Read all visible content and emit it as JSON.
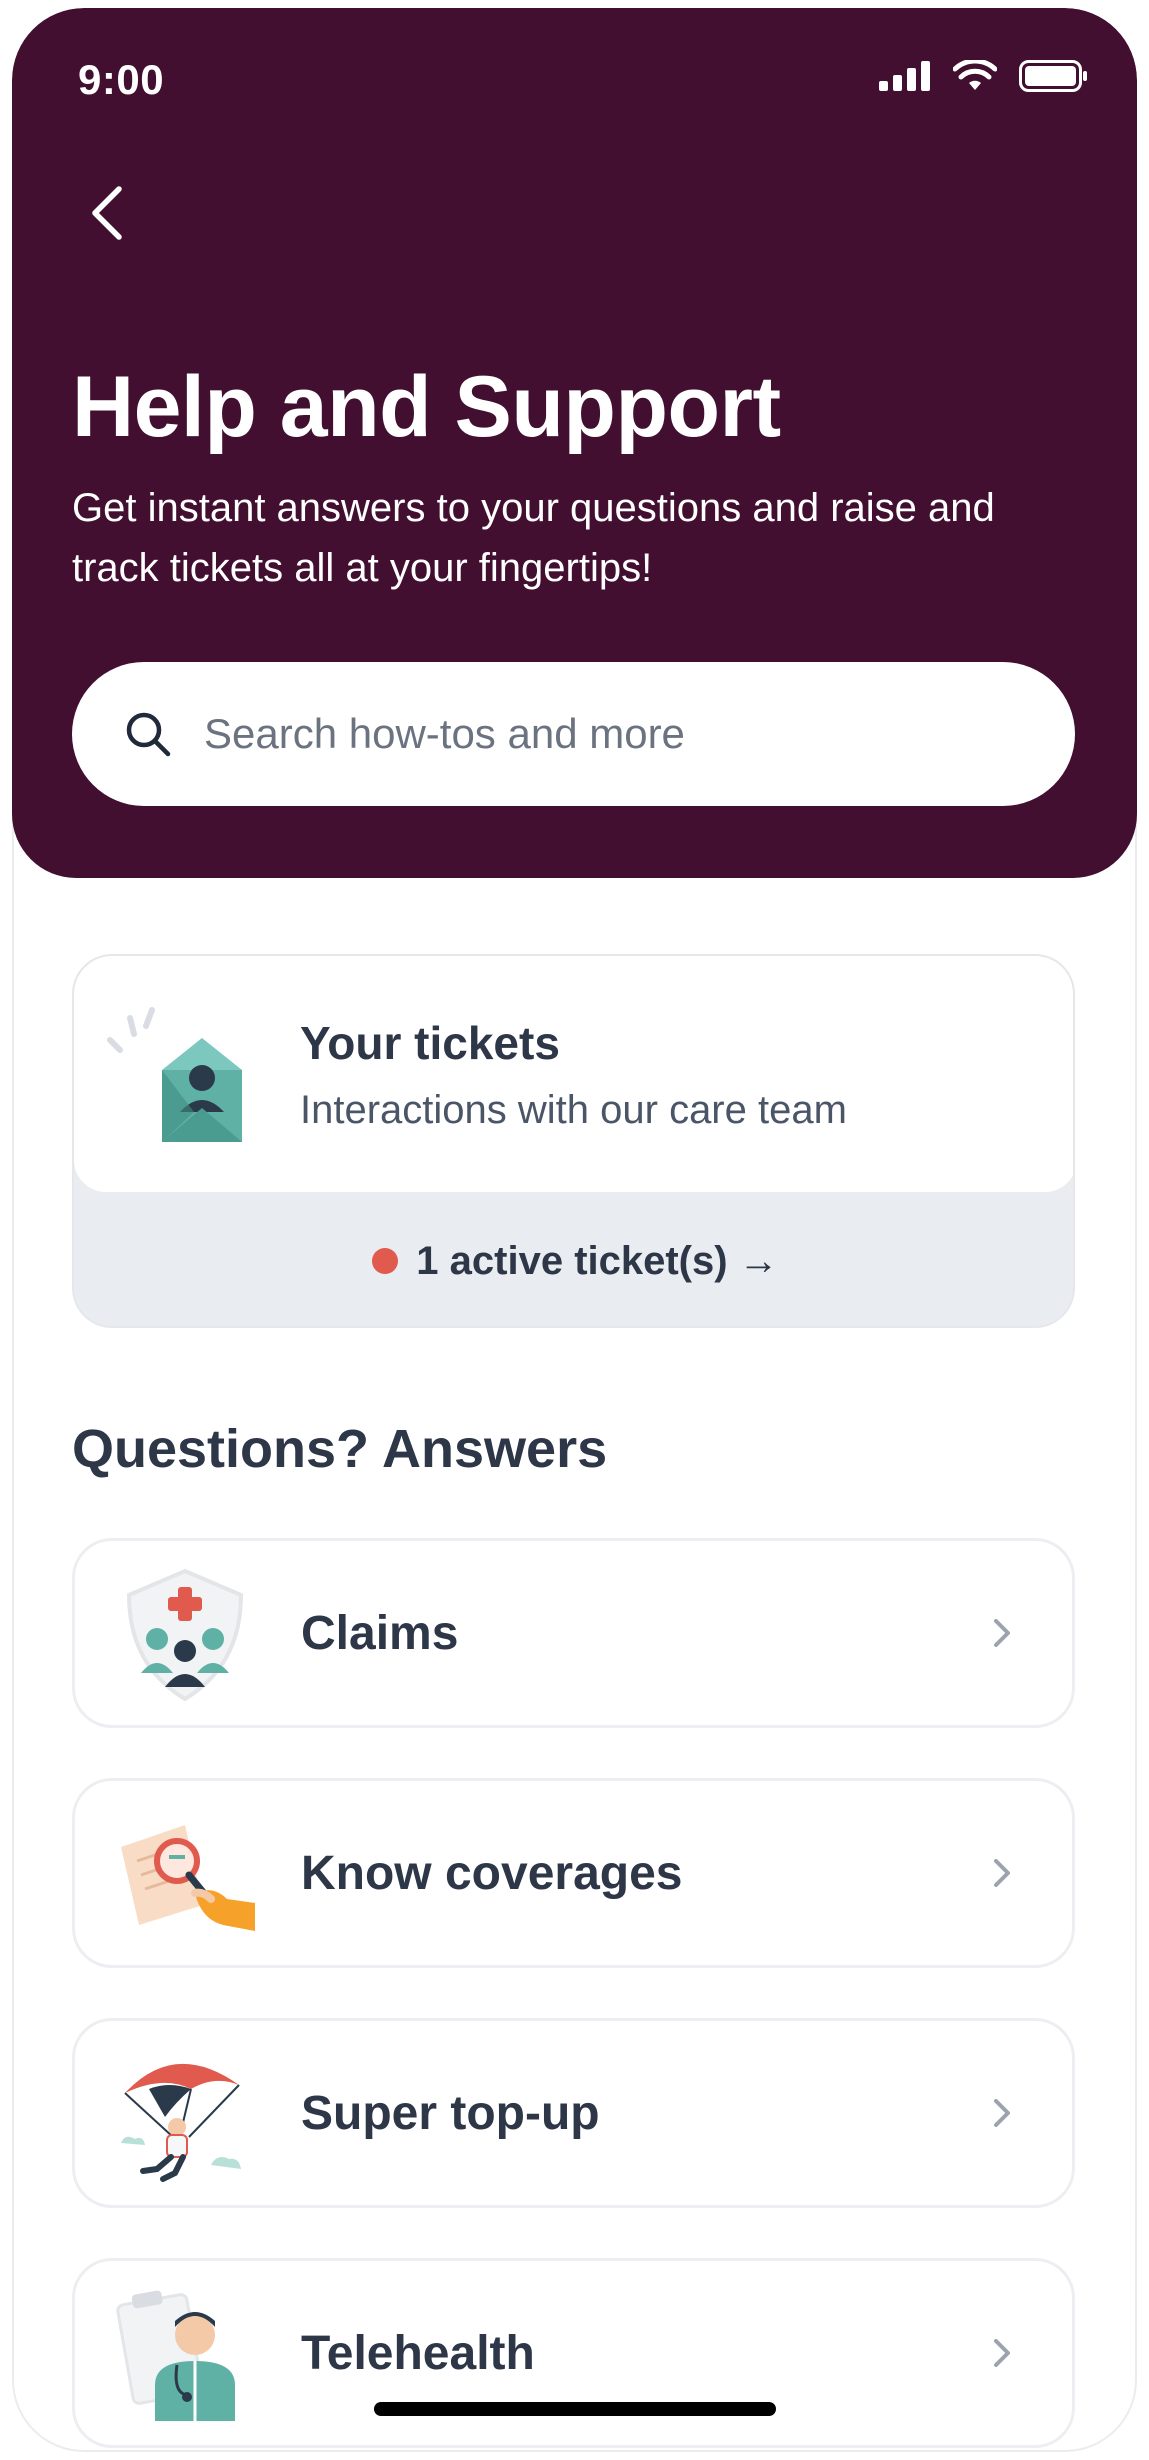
{
  "status_bar": {
    "time": "9:00"
  },
  "header": {
    "title": "Help and Support",
    "subtitle": "Get instant answers to your questions and raise and track tickets all at your fingertips!",
    "back_icon": "chevron-left-icon"
  },
  "search": {
    "placeholder": "Search how-tos and more",
    "value": "",
    "icon": "search-icon"
  },
  "tickets": {
    "title": "Your tickets",
    "subtitle": "Interactions with our care team",
    "active_label": "1 active ticket(s) →",
    "status_color": "#e05a4e"
  },
  "qa_section": {
    "title": "Questions? Answers",
    "items": [
      {
        "label": "Claims",
        "icon": "shield-family-icon"
      },
      {
        "label": "Know coverages",
        "icon": "magnifier-document-icon"
      },
      {
        "label": "Super top-up",
        "icon": "parachute-icon"
      },
      {
        "label": "Telehealth",
        "icon": "doctor-icon"
      }
    ]
  },
  "colors": {
    "header_bg": "#420f30",
    "text_primary": "#2d3748",
    "card_footer_bg": "#e9ecf1"
  }
}
